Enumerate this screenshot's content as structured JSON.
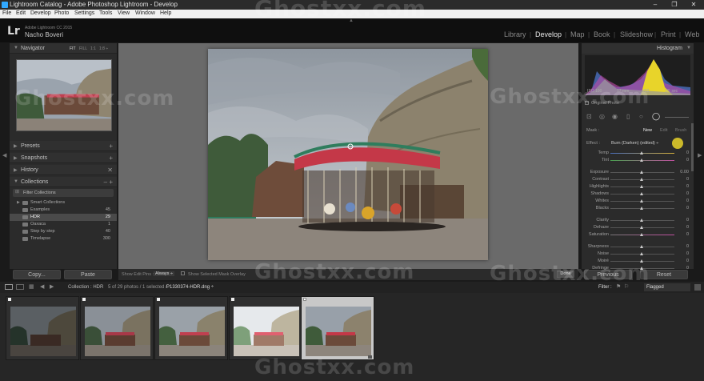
{
  "window": {
    "title": "Lightroom Catalog - Adobe Photoshop Lightroom - Develop",
    "minimize": "–",
    "maximize": "❐",
    "close": "✕"
  },
  "menu": [
    "File",
    "Edit",
    "Develop",
    "Photo",
    "Settings",
    "Tools",
    "View",
    "Window",
    "Help"
  ],
  "identity": {
    "logo": "Lr",
    "product": "Adobe Lightroom CC 2015",
    "user": "Nacho Boveri"
  },
  "modules": [
    "Library",
    "Develop",
    "Map",
    "Book",
    "Slideshow",
    "Print",
    "Web"
  ],
  "active_module": "Develop",
  "left_panel": {
    "navigator": {
      "label": "Navigator",
      "zoom": [
        "FIT",
        "FILL",
        "1:1",
        "1:8 ÷"
      ]
    },
    "presets": {
      "label": "Presets",
      "action": "+"
    },
    "snapshots": {
      "label": "Snapshots",
      "action": "+"
    },
    "history": {
      "label": "History",
      "action": "✕"
    },
    "collections": {
      "label": "Collections",
      "action": "– +",
      "filter": "Filter Collections",
      "items": [
        {
          "name": "Smart Collections",
          "count": ""
        },
        {
          "name": "Examples",
          "count": "45"
        },
        {
          "name": "HDR",
          "count": "29"
        },
        {
          "name": "Oaxaca",
          "count": "1"
        },
        {
          "name": "Step by step",
          "count": "40"
        },
        {
          "name": "Timelapse",
          "count": "300"
        }
      ]
    },
    "copy": "Copy...",
    "paste": "Paste"
  },
  "toolbar": {
    "show_edit_pins": "Show Edit Pins :",
    "pins_value": "Always ÷",
    "show_overlay": "Show Selected Mask Overlay",
    "done": "Done"
  },
  "right_panel": {
    "histogram": "Histogram",
    "original_photo": "Original Photo",
    "histo_info": [
      "ISO 100",
      "17 mm",
      "f/22",
      "1/5 sec"
    ],
    "mask_label": "Mask :",
    "mask_new": "New",
    "mask_edit": "Edit",
    "mask_brush": "Brush",
    "effect_label": "Effect :",
    "effect_value": "Burn (Darken) (edited) ÷",
    "sliders": [
      {
        "label": "Temp",
        "value": "0"
      },
      {
        "label": "Tint",
        "value": "0"
      },
      {
        "label": "Exposure",
        "value": "0.00"
      },
      {
        "label": "Contrast",
        "value": "0"
      },
      {
        "label": "Highlights",
        "value": "0"
      },
      {
        "label": "Shadows",
        "value": "0"
      },
      {
        "label": "Whites",
        "value": "0"
      },
      {
        "label": "Blacks",
        "value": "0"
      },
      {
        "label": "Clarity",
        "value": "0"
      },
      {
        "label": "Dehaze",
        "value": "0"
      },
      {
        "label": "Saturation",
        "value": "0"
      },
      {
        "label": "Sharpness",
        "value": "0"
      },
      {
        "label": "Noise",
        "value": "0"
      },
      {
        "label": "Moiré",
        "value": "0"
      },
      {
        "label": "Defringe",
        "value": "0"
      }
    ],
    "previous": "Previous",
    "reset": "Reset"
  },
  "filmbar": {
    "source": "Collection : HDR",
    "selection": "5 of 29 photos / 1 selected /",
    "filename": "P1330374-HDR.dng ÷",
    "filter_label": "Filter :",
    "filter_value": "Flagged"
  },
  "watermark": "Ghostxx.com",
  "colors": {
    "accent": "#e8e8e8",
    "pin": "#e8d22a",
    "panel": "#2b2b2b"
  }
}
